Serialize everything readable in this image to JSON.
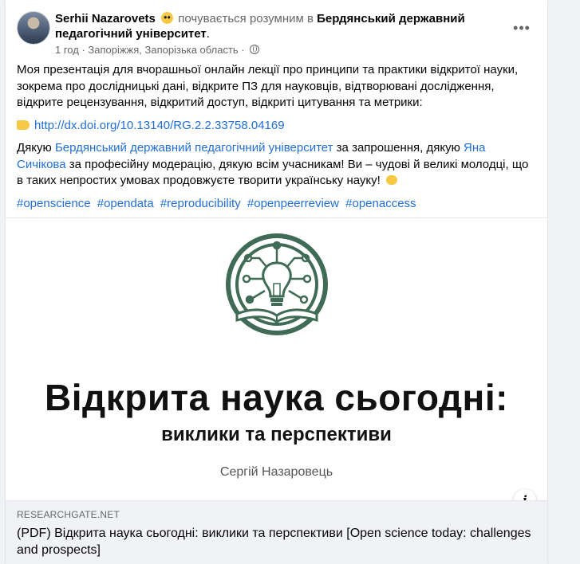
{
  "post": {
    "author_name": "Serhii Nazarovets",
    "feeling_text": "почувається розумним в",
    "page_name": "Бердянський державний педагогічний університет",
    "page_suffix": ".",
    "time": "1 год",
    "location": "· Запоріжжя, Запорізька область ·",
    "more_label": "•••",
    "paragraph1": "Моя презентація для вчорашньої онлайн лекції про принципи та практики відкритої науки, зокрема про дослідницькі дані, відкрите ПЗ для науковців, відтворювані дослідження, відкрите рецензування, відкритий доступ, відкриті цитування та метрики:",
    "doi_link": "http://dx.doi.org/10.13140/RG.2.2.33758.04169",
    "p3_before": "Дякую ",
    "p3_link1": "Бердянський державний педагогічний університет",
    "p3_middle": " за запрошення, дякую ",
    "p3_link2": "Яна Сичікова",
    "p3_after": " за професійну модерацію, дякую всім учасникам! Ви – чудові й великі молодці, що в таких непростих умовах продовжуєте творити українську науку!",
    "hashtags": [
      "#openscience",
      "#opendata",
      "#reproducibility",
      "#openpeerreview",
      "#openaccess"
    ]
  },
  "preview": {
    "title_big": "Відкрита наука сьогодні:",
    "title_small": "виклики та перспективи",
    "author": "Сергій Назаровець",
    "info_label": "i"
  },
  "link": {
    "domain": "RESEARCHGATE.NET",
    "title": "(PDF) Відкрита наука сьогодні: виклики та перспективи [Open science today: challenges and prospects]"
  },
  "colors": {
    "link": "#216fdb",
    "logo_green": "#3f6b57",
    "background": "#f0f2f5"
  }
}
